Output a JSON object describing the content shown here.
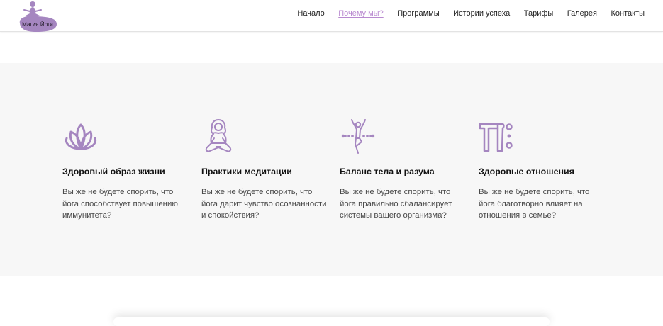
{
  "logo": {
    "text": "Магия Йоги",
    "color": "#a586c0"
  },
  "nav": {
    "items": [
      {
        "label": "Начало"
      },
      {
        "label": "Почему мы?",
        "active": true
      },
      {
        "label": "Программы"
      },
      {
        "label": "Истории успеха"
      },
      {
        "label": "Тарифы"
      },
      {
        "label": "Галерея"
      },
      {
        "label": "Контакты"
      }
    ],
    "active_color": "#b98ad0"
  },
  "features": [
    {
      "icon": "lotus-icon",
      "title": "Здоровый образ жизни",
      "text": "Вы же не будете спорить, что йога способствует повышению иммунитета?"
    },
    {
      "icon": "meditation-icon",
      "title": "Практики медитации",
      "text": "Вы же не будете спорить, что йога дарит чувство осознанности и спокойствия?"
    },
    {
      "icon": "yoga-pose-icon",
      "title": "Баланс тела и разума",
      "text": "Вы же не будете спорить, что йога правильно сбалансирует системы вашего организма?"
    },
    {
      "icon": "partner-yoga-icon",
      "title": "Здоровые отношения",
      "text": "Вы же не будете спорить, что йога благотворно влияет на отношения в семье?"
    }
  ],
  "icon_color": "#a586c0",
  "section_bg": "#f7f7f7"
}
